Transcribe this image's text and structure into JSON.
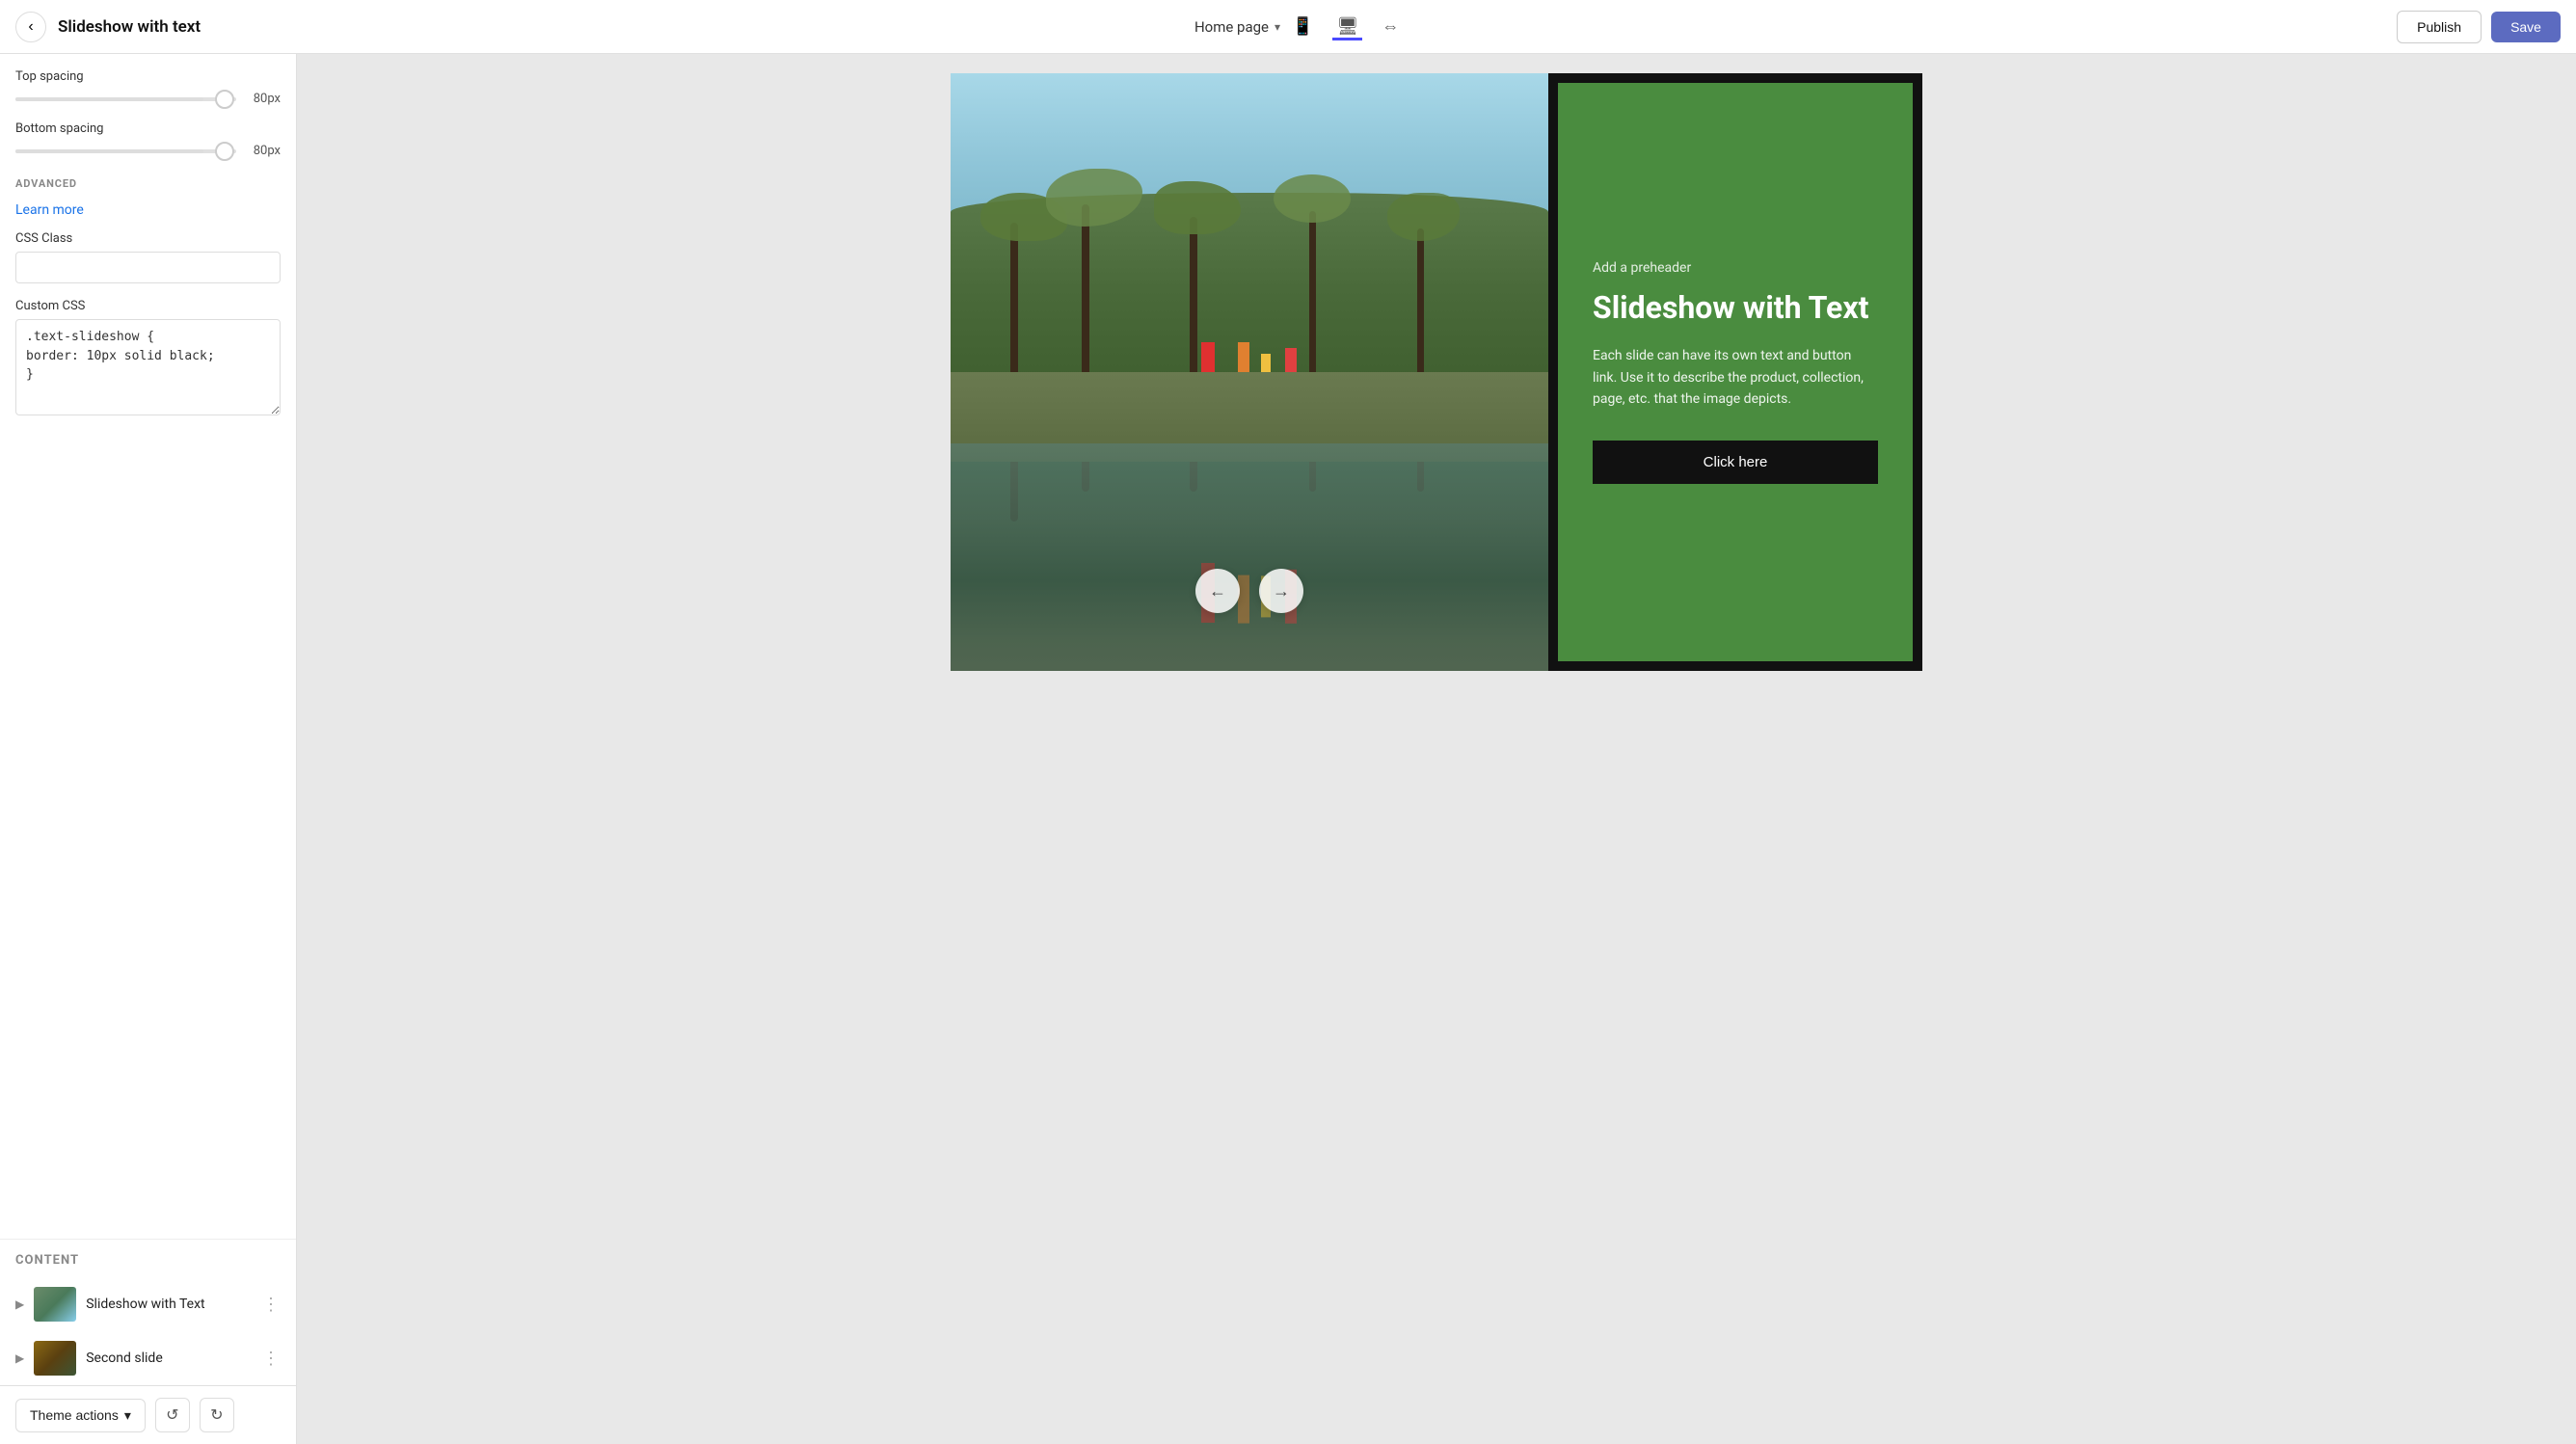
{
  "topbar": {
    "back_label": "‹",
    "title": "Slideshow with text",
    "page_selector": "Home page",
    "chevron": "▾",
    "publish_label": "Publish",
    "save_label": "Save"
  },
  "sidebar": {
    "top_spacing_label": "Top spacing",
    "top_spacing_value": "80px",
    "bottom_spacing_label": "Bottom spacing",
    "bottom_spacing_value": "80px",
    "advanced_label": "ADVANCED",
    "learn_more_label": "Learn more",
    "css_class_label": "CSS Class",
    "css_class_placeholder": "",
    "custom_css_label": "Custom CSS",
    "custom_css_value": ".text-slideshow {\nborder: 10px solid black;\n}",
    "content_label": "CONTENT",
    "slides": [
      {
        "name": "Slideshow with Text",
        "id": "slide-1"
      },
      {
        "name": "Second slide",
        "id": "slide-2"
      }
    ],
    "theme_actions_label": "Theme actions"
  },
  "canvas": {
    "preheader": "Add a preheader",
    "heading": "Slideshow with Text",
    "body_text": "Each slide can have its own text and button link. Use it to describe the product, collection, page, etc. that the image depicts.",
    "cta_label": "Click here",
    "prev_arrow": "←",
    "next_arrow": "→"
  }
}
